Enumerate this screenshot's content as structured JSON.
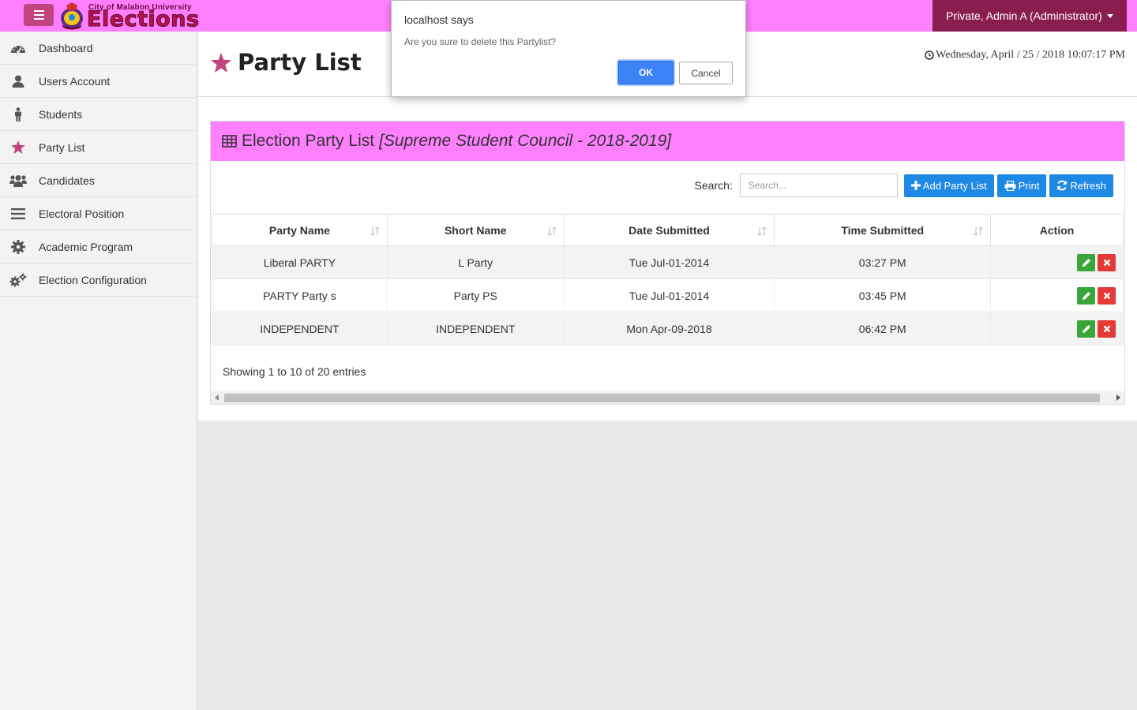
{
  "topbar": {
    "brand_sub": "City of Malabon University",
    "brand_main": "Elections",
    "user_label": "Private, Admin A (Administrator)",
    "accent": "#ff80ff",
    "user_bg": "#8a1d4f"
  },
  "sidebar": {
    "items": [
      {
        "label": "Dashboard",
        "icon": "dashboard-icon"
      },
      {
        "label": "Users Account",
        "icon": "user-icon"
      },
      {
        "label": "Students",
        "icon": "student-icon"
      },
      {
        "label": "Party List",
        "icon": "star-icon"
      },
      {
        "label": "Candidates",
        "icon": "users-icon"
      },
      {
        "label": "Electoral Position",
        "icon": "bars-icon"
      },
      {
        "label": "Academic Program",
        "icon": "gear-icon"
      },
      {
        "label": "Election Configuration",
        "icon": "cogs-icon"
      }
    ]
  },
  "header": {
    "title": "Party List",
    "datetime": "Wednesday, April / 25 / 2018 10:07:17 PM"
  },
  "panel": {
    "title": "Election Party List",
    "subtitle": "[Supreme Student Council - 2018-2019]",
    "search_label": "Search:",
    "search_placeholder": "Search...",
    "buttons": {
      "add": "Add Party List",
      "print": "Print",
      "refresh": "Refresh"
    },
    "columns": [
      "Party Name",
      "Short Name",
      "Date Submitted",
      "Time Submitted",
      "Action"
    ],
    "rows": [
      [
        "Liberal PARTY",
        "L Party",
        "Tue Jul-01-2014",
        "03:27 PM"
      ],
      [
        "PARTY Party s",
        "Party PS",
        "Tue Jul-01-2014",
        "03:45 PM"
      ],
      [
        "INDEPENDENT",
        "INDEPENDENT",
        "Mon Apr-09-2018",
        "06:42 PM"
      ]
    ],
    "info": "Showing 1 to 10 of 20 entries"
  },
  "dialog": {
    "title": "localhost says",
    "message": "Are you sure to delete this Partylist?",
    "ok": "OK",
    "cancel": "Cancel"
  }
}
